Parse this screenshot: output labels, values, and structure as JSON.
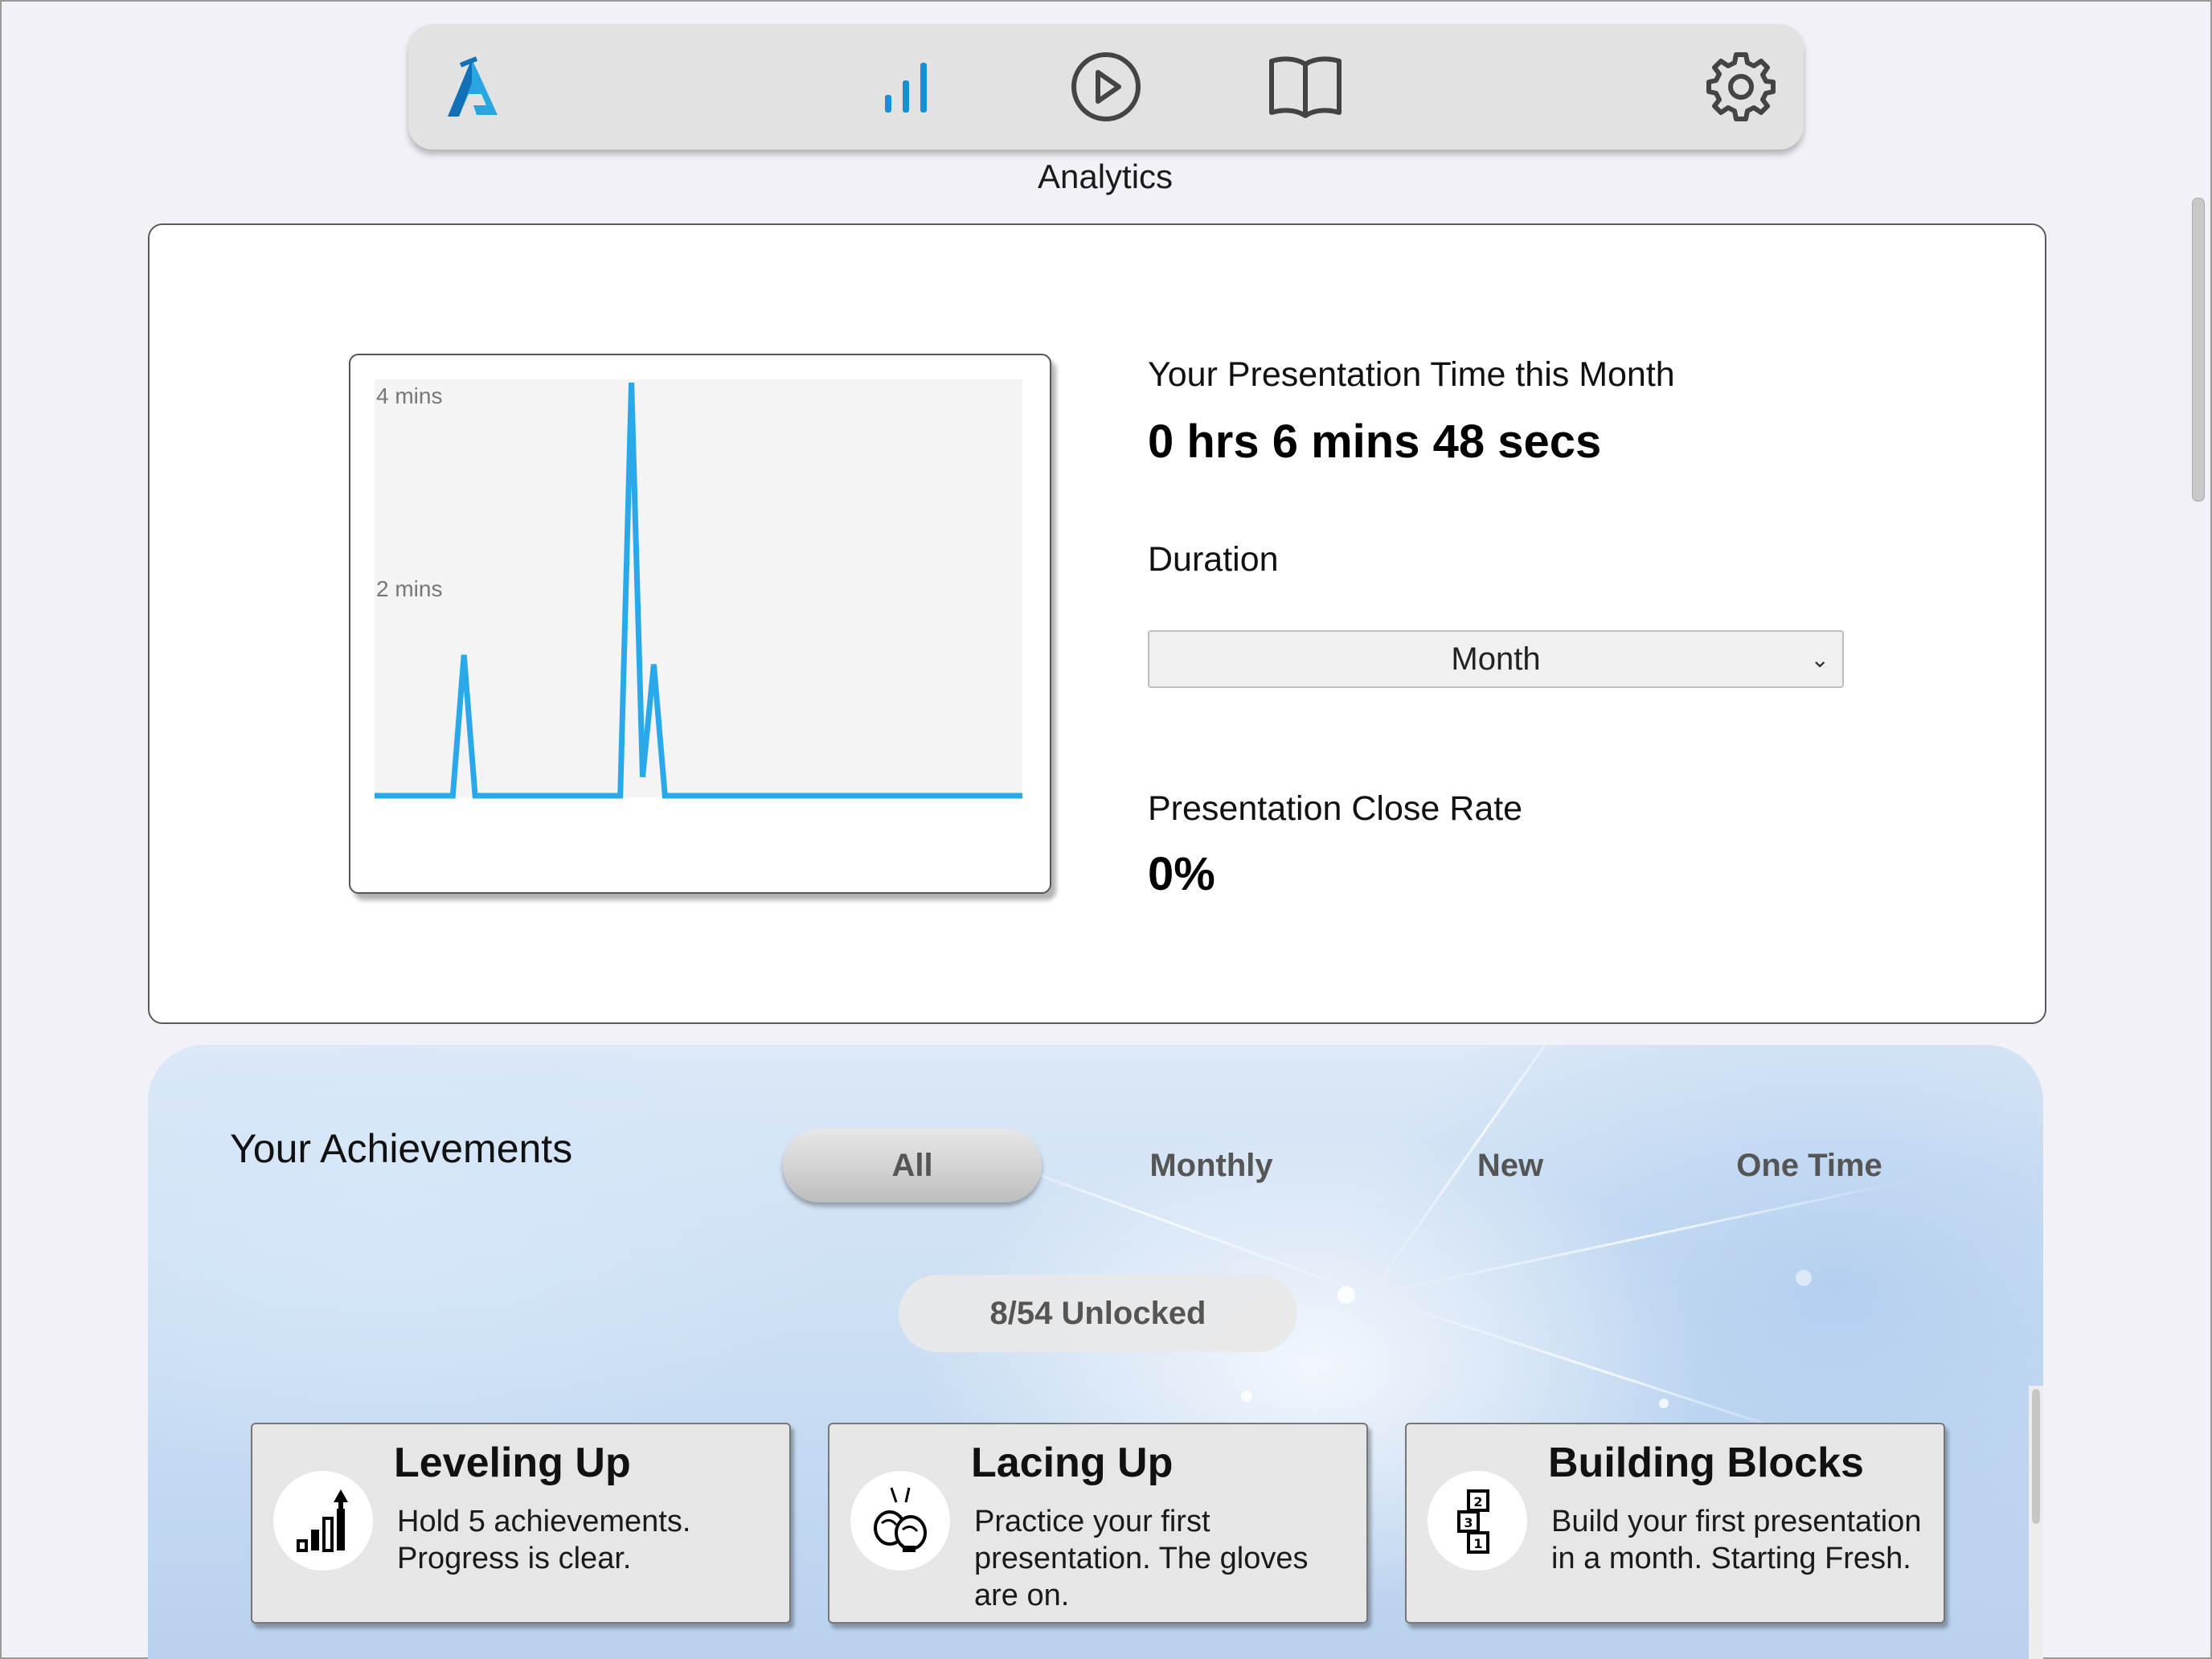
{
  "nav": {
    "items": [
      {
        "name": "logo",
        "icon": "brand-logo-icon"
      },
      {
        "name": "analytics",
        "icon": "bar-chart-icon"
      },
      {
        "name": "practice",
        "icon": "play-circle-icon"
      },
      {
        "name": "library",
        "icon": "book-icon"
      },
      {
        "name": "settings",
        "icon": "gear-icon"
      }
    ],
    "active_label": "Analytics",
    "accent_color": "#1a8fd6"
  },
  "analytics": {
    "presentation_time_label": "Your Presentation Time this Month",
    "presentation_time_value": "0 hrs 6 mins 48 secs",
    "duration_label": "Duration",
    "duration_selected": "Month",
    "close_rate_label": "Presentation Close Rate",
    "close_rate_value": "0%"
  },
  "chart_data": {
    "type": "line",
    "title": "",
    "xlabel": "",
    "ylabel": "",
    "y_ticks": [
      "4 mins",
      "2 mins"
    ],
    "ylim": [
      0,
      4.4
    ],
    "grid": false,
    "color": "#29a9ea",
    "series": [
      {
        "values": [
          0,
          0,
          0,
          0,
          0,
          0,
          0,
          0,
          1.5,
          0,
          0,
          0,
          0,
          0,
          0,
          0,
          0,
          0,
          0,
          0,
          0,
          0,
          0,
          4.4,
          0.2,
          1.4,
          0,
          0,
          0,
          0,
          0,
          0,
          0,
          0,
          0,
          0,
          0,
          0,
          0,
          0,
          0,
          0,
          0,
          0,
          0,
          0,
          0,
          0,
          0,
          0,
          0,
          0,
          0,
          0,
          0,
          0,
          0,
          0,
          0
        ]
      }
    ]
  },
  "achievements": {
    "title": "Your Achievements",
    "filters": [
      "All",
      "Monthly",
      "New",
      "One Time"
    ],
    "active_filter": "All",
    "unlocked_text": "8/54 Unlocked",
    "cards": [
      {
        "name": "Leveling Up",
        "description": "Hold 5 achievements. Progress is clear.",
        "icon": "growth-bars-icon"
      },
      {
        "name": "Lacing Up",
        "description": "Practice your first presentation. The gloves are on.",
        "icon": "boxing-gloves-icon"
      },
      {
        "name": "Building Blocks",
        "description": "Build your first presentation in a month. Starting Fresh.",
        "icon": "number-blocks-icon"
      }
    ]
  }
}
